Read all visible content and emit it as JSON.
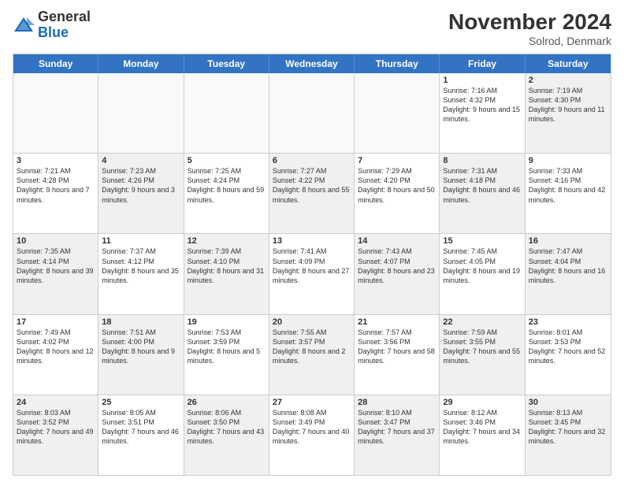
{
  "logo": {
    "general": "General",
    "blue": "Blue"
  },
  "title": "November 2024",
  "location": "Solrod, Denmark",
  "header_days": [
    "Sunday",
    "Monday",
    "Tuesday",
    "Wednesday",
    "Thursday",
    "Friday",
    "Saturday"
  ],
  "rows": [
    [
      {
        "day": "",
        "text": "",
        "empty": true
      },
      {
        "day": "",
        "text": "",
        "empty": true
      },
      {
        "day": "",
        "text": "",
        "empty": true
      },
      {
        "day": "",
        "text": "",
        "empty": true
      },
      {
        "day": "",
        "text": "",
        "empty": true
      },
      {
        "day": "1",
        "text": "Sunrise: 7:16 AM\nSunset: 4:32 PM\nDaylight: 9 hours and 15 minutes.",
        "empty": false,
        "shaded": false
      },
      {
        "day": "2",
        "text": "Sunrise: 7:19 AM\nSunset: 4:30 PM\nDaylight: 9 hours and 11 minutes.",
        "empty": false,
        "shaded": true
      }
    ],
    [
      {
        "day": "3",
        "text": "Sunrise: 7:21 AM\nSunset: 4:28 PM\nDaylight: 9 hours and 7 minutes.",
        "empty": false,
        "shaded": false
      },
      {
        "day": "4",
        "text": "Sunrise: 7:23 AM\nSunset: 4:26 PM\nDaylight: 9 hours and 3 minutes.",
        "empty": false,
        "shaded": true
      },
      {
        "day": "5",
        "text": "Sunrise: 7:25 AM\nSunset: 4:24 PM\nDaylight: 8 hours and 59 minutes.",
        "empty": false,
        "shaded": false
      },
      {
        "day": "6",
        "text": "Sunrise: 7:27 AM\nSunset: 4:22 PM\nDaylight: 8 hours and 55 minutes.",
        "empty": false,
        "shaded": true
      },
      {
        "day": "7",
        "text": "Sunrise: 7:29 AM\nSunset: 4:20 PM\nDaylight: 8 hours and 50 minutes.",
        "empty": false,
        "shaded": false
      },
      {
        "day": "8",
        "text": "Sunrise: 7:31 AM\nSunset: 4:18 PM\nDaylight: 8 hours and 46 minutes.",
        "empty": false,
        "shaded": true
      },
      {
        "day": "9",
        "text": "Sunrise: 7:33 AM\nSunset: 4:16 PM\nDaylight: 8 hours and 42 minutes.",
        "empty": false,
        "shaded": false
      }
    ],
    [
      {
        "day": "10",
        "text": "Sunrise: 7:35 AM\nSunset: 4:14 PM\nDaylight: 8 hours and 39 minutes.",
        "empty": false,
        "shaded": true
      },
      {
        "day": "11",
        "text": "Sunrise: 7:37 AM\nSunset: 4:12 PM\nDaylight: 8 hours and 35 minutes.",
        "empty": false,
        "shaded": false
      },
      {
        "day": "12",
        "text": "Sunrise: 7:39 AM\nSunset: 4:10 PM\nDaylight: 8 hours and 31 minutes.",
        "empty": false,
        "shaded": true
      },
      {
        "day": "13",
        "text": "Sunrise: 7:41 AM\nSunset: 4:09 PM\nDaylight: 8 hours and 27 minutes.",
        "empty": false,
        "shaded": false
      },
      {
        "day": "14",
        "text": "Sunrise: 7:43 AM\nSunset: 4:07 PM\nDaylight: 8 hours and 23 minutes.",
        "empty": false,
        "shaded": true
      },
      {
        "day": "15",
        "text": "Sunrise: 7:45 AM\nSunset: 4:05 PM\nDaylight: 8 hours and 19 minutes.",
        "empty": false,
        "shaded": false
      },
      {
        "day": "16",
        "text": "Sunrise: 7:47 AM\nSunset: 4:04 PM\nDaylight: 8 hours and 16 minutes.",
        "empty": false,
        "shaded": true
      }
    ],
    [
      {
        "day": "17",
        "text": "Sunrise: 7:49 AM\nSunset: 4:02 PM\nDaylight: 8 hours and 12 minutes.",
        "empty": false,
        "shaded": false
      },
      {
        "day": "18",
        "text": "Sunrise: 7:51 AM\nSunset: 4:00 PM\nDaylight: 8 hours and 9 minutes.",
        "empty": false,
        "shaded": true
      },
      {
        "day": "19",
        "text": "Sunrise: 7:53 AM\nSunset: 3:59 PM\nDaylight: 8 hours and 5 minutes.",
        "empty": false,
        "shaded": false
      },
      {
        "day": "20",
        "text": "Sunrise: 7:55 AM\nSunset: 3:57 PM\nDaylight: 8 hours and 2 minutes.",
        "empty": false,
        "shaded": true
      },
      {
        "day": "21",
        "text": "Sunrise: 7:57 AM\nSunset: 3:56 PM\nDaylight: 7 hours and 58 minutes.",
        "empty": false,
        "shaded": false
      },
      {
        "day": "22",
        "text": "Sunrise: 7:59 AM\nSunset: 3:55 PM\nDaylight: 7 hours and 55 minutes.",
        "empty": false,
        "shaded": true
      },
      {
        "day": "23",
        "text": "Sunrise: 8:01 AM\nSunset: 3:53 PM\nDaylight: 7 hours and 52 minutes.",
        "empty": false,
        "shaded": false
      }
    ],
    [
      {
        "day": "24",
        "text": "Sunrise: 8:03 AM\nSunset: 3:52 PM\nDaylight: 7 hours and 49 minutes.",
        "empty": false,
        "shaded": true
      },
      {
        "day": "25",
        "text": "Sunrise: 8:05 AM\nSunset: 3:51 PM\nDaylight: 7 hours and 46 minutes.",
        "empty": false,
        "shaded": false
      },
      {
        "day": "26",
        "text": "Sunrise: 8:06 AM\nSunset: 3:50 PM\nDaylight: 7 hours and 43 minutes.",
        "empty": false,
        "shaded": true
      },
      {
        "day": "27",
        "text": "Sunrise: 8:08 AM\nSunset: 3:49 PM\nDaylight: 7 hours and 40 minutes.",
        "empty": false,
        "shaded": false
      },
      {
        "day": "28",
        "text": "Sunrise: 8:10 AM\nSunset: 3:47 PM\nDaylight: 7 hours and 37 minutes.",
        "empty": false,
        "shaded": true
      },
      {
        "day": "29",
        "text": "Sunrise: 8:12 AM\nSunset: 3:46 PM\nDaylight: 7 hours and 34 minutes.",
        "empty": false,
        "shaded": false
      },
      {
        "day": "30",
        "text": "Sunrise: 8:13 AM\nSunset: 3:45 PM\nDaylight: 7 hours and 32 minutes.",
        "empty": false,
        "shaded": true
      }
    ]
  ]
}
